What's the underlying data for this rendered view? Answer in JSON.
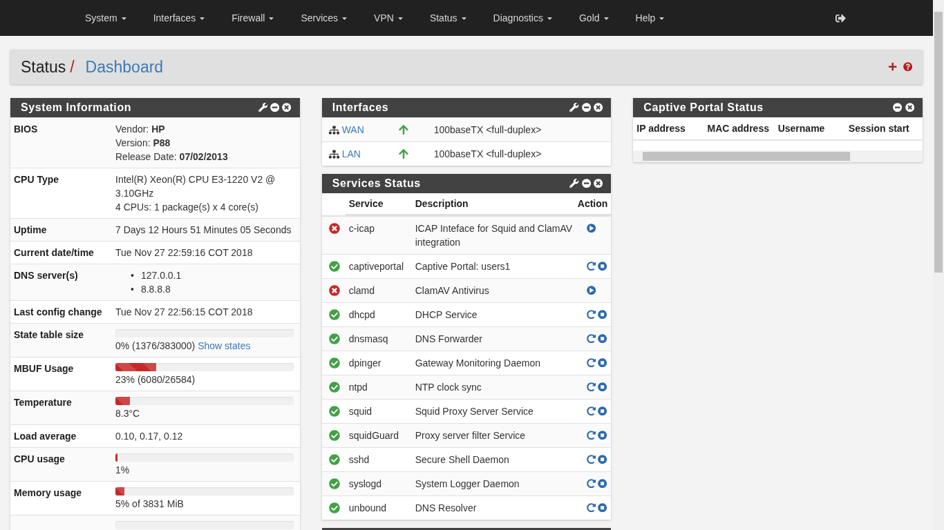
{
  "nav": {
    "items": [
      {
        "label": "System"
      },
      {
        "label": "Interfaces"
      },
      {
        "label": "Firewall"
      },
      {
        "label": "Services"
      },
      {
        "label": "VPN"
      },
      {
        "label": "Status"
      },
      {
        "label": "Diagnostics"
      },
      {
        "label": "Gold"
      },
      {
        "label": "Help"
      }
    ]
  },
  "breadcrumb": {
    "parent": "Status",
    "separator": "/",
    "current": "Dashboard"
  },
  "system_information": {
    "title": "System Information",
    "rows": [
      {
        "label": "BIOS",
        "kind": "lines",
        "lines": [
          "Vendor: **HP**",
          "Version: **P88**",
          "Release Date: **07/02/2013**"
        ]
      },
      {
        "label": "CPU Type",
        "kind": "lines",
        "lines": [
          "Intel(R) Xeon(R) CPU E3-1220 V2 @ 3.10GHz",
          "4 CPUs: 1 package(s) x 4 core(s)"
        ]
      },
      {
        "label": "Uptime",
        "kind": "lines",
        "lines": [
          "7 Days 12 Hours 51 Minutes 05 Seconds"
        ]
      },
      {
        "label": "Current date/time",
        "kind": "lines",
        "lines": [
          "Tue Nov 27 22:59:16 COT 2018"
        ]
      },
      {
        "label": "DNS server(s)",
        "kind": "list",
        "bullet": "•",
        "items": [
          "127.0.0.1",
          "8.8.8.8"
        ]
      },
      {
        "label": "Last config change",
        "kind": "lines",
        "lines": [
          "Tue Nov 27 22:56:15 COT 2018"
        ]
      },
      {
        "label": "State table size",
        "kind": "meter",
        "level": 0,
        "reading": "0% (1376/383000)",
        "link": "Show states"
      },
      {
        "label": "MBUF Usage",
        "kind": "meter",
        "level": 0.23,
        "reading": "23% (6080/26584)"
      },
      {
        "label": "Temperature",
        "kind": "meter",
        "level": 0.083,
        "reading": "8.3°C"
      },
      {
        "label": "Load average",
        "kind": "lines",
        "lines": [
          "0.10, 0.17, 0.12"
        ]
      },
      {
        "label": "CPU usage",
        "kind": "meter",
        "level": 0.01,
        "reading": "1%"
      },
      {
        "label": "Memory usage",
        "kind": "meter",
        "level": 0.05,
        "reading": "5% of 3831 MiB"
      },
      {
        "kind": "meter",
        "level": 0
      }
    ]
  },
  "interfaces": {
    "title": "Interfaces",
    "rows": [
      {
        "name": "WAN",
        "up": true,
        "media": "100baseTX <full-duplex>"
      },
      {
        "name": "LAN",
        "up": true,
        "media": "100baseTX <full-duplex>"
      }
    ]
  },
  "services_status": {
    "title": "Services Status",
    "columns": [
      "Service",
      "Description",
      "Action"
    ],
    "rows": [
      {
        "name": "c-icap",
        "description": "ICAP Inteface for Squid and ClamAV integration",
        "running": false
      },
      {
        "name": "captiveportal",
        "description": "Captive Portal: users1",
        "running": true
      },
      {
        "name": "clamd",
        "description": "ClamAV Antivirus",
        "running": false
      },
      {
        "name": "dhcpd",
        "description": "DHCP Service",
        "running": true
      },
      {
        "name": "dnsmasq",
        "description": "DNS Forwarder",
        "running": true
      },
      {
        "name": "dpinger",
        "description": "Gateway Monitoring Daemon",
        "running": true
      },
      {
        "name": "ntpd",
        "description": "NTP clock sync",
        "running": true
      },
      {
        "name": "squid",
        "description": "Squid Proxy Server Service",
        "running": true
      },
      {
        "name": "squidGuard",
        "description": "Proxy server filter Service",
        "running": true
      },
      {
        "name": "sshd",
        "description": "Secure Shell Daemon",
        "running": true
      },
      {
        "name": "syslogd",
        "description": "System Logger Daemon",
        "running": true
      },
      {
        "name": "unbound",
        "description": "DNS Resolver",
        "running": true
      }
    ]
  },
  "captive_portal_status": {
    "title": "Captive Portal Status",
    "columns": [
      "IP address",
      "MAC address",
      "Username",
      "Session start"
    ]
  }
}
